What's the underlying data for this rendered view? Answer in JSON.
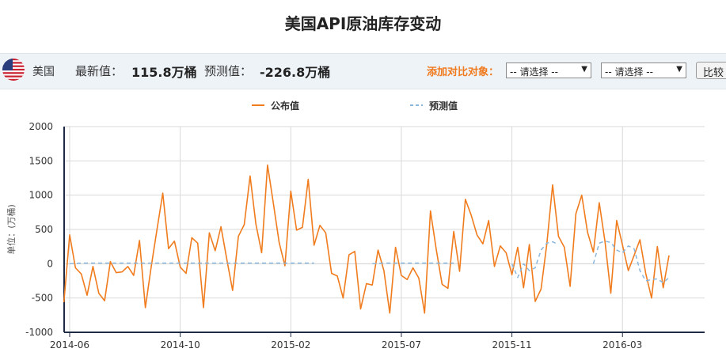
{
  "page": {
    "title": "美国API原油库存变动"
  },
  "infobar": {
    "country": "美国",
    "latest_label": "最新值：",
    "latest_value": "115.8万桶",
    "forecast_label": "预测值：",
    "forecast_value": "-226.8万桶",
    "compare_label": "添加对比对象：",
    "select1_value": "-- 请选择 --",
    "select2_value": "-- 请选择 --",
    "compare_button": "比较"
  },
  "chart_data": {
    "type": "line",
    "ylabel": "单位：(万桶)",
    "ylim": [
      -1000,
      2000
    ],
    "yticks": [
      2000,
      1500,
      1000,
      500,
      0,
      -500,
      -1000
    ],
    "xlim": [
      0,
      112
    ],
    "xticks": [
      {
        "label": "2014-06",
        "x": 0
      },
      {
        "label": "2014-10",
        "x": 19
      },
      {
        "label": "2015-02",
        "x": 38
      },
      {
        "label": "2015-07",
        "x": 57
      },
      {
        "label": "2015-11",
        "x": 76
      },
      {
        "label": "2016-03",
        "x": 95
      }
    ],
    "grid": true,
    "legend_position": "top",
    "series": [
      {
        "name": "公布值",
        "color": "#f07c1e",
        "style": "solid",
        "points": [
          [
            -1,
            -560
          ],
          [
            0,
            420
          ],
          [
            1,
            -60
          ],
          [
            2,
            -150
          ],
          [
            3,
            -460
          ],
          [
            4,
            -40
          ],
          [
            5,
            -430
          ],
          [
            6,
            -540
          ],
          [
            7,
            30
          ],
          [
            8,
            -130
          ],
          [
            9,
            -120
          ],
          [
            10,
            -40
          ],
          [
            11,
            -170
          ],
          [
            12,
            340
          ],
          [
            13,
            -640
          ],
          [
            14,
            -50
          ],
          [
            15,
            500
          ],
          [
            16,
            1030
          ],
          [
            17,
            220
          ],
          [
            18,
            330
          ],
          [
            19,
            -50
          ],
          [
            20,
            -140
          ],
          [
            21,
            380
          ],
          [
            22,
            300
          ],
          [
            23,
            -640
          ],
          [
            24,
            450
          ],
          [
            25,
            190
          ],
          [
            26,
            540
          ],
          [
            27,
            70
          ],
          [
            28,
            -390
          ],
          [
            29,
            400
          ],
          [
            30,
            570
          ],
          [
            31,
            1280
          ],
          [
            32,
            580
          ],
          [
            33,
            160
          ],
          [
            34,
            1440
          ],
          [
            35,
            880
          ],
          [
            36,
            310
          ],
          [
            37,
            -30
          ],
          [
            38,
            1060
          ],
          [
            39,
            490
          ],
          [
            40,
            530
          ],
          [
            41,
            1230
          ],
          [
            42,
            270
          ],
          [
            43,
            560
          ],
          [
            44,
            450
          ],
          [
            45,
            -140
          ],
          [
            46,
            -180
          ],
          [
            47,
            -500
          ],
          [
            48,
            130
          ],
          [
            49,
            180
          ],
          [
            50,
            -660
          ],
          [
            51,
            -290
          ],
          [
            52,
            -310
          ],
          [
            53,
            200
          ],
          [
            54,
            -100
          ],
          [
            55,
            -720
          ],
          [
            56,
            240
          ],
          [
            57,
            -170
          ],
          [
            58,
            -230
          ],
          [
            59,
            -60
          ],
          [
            60,
            -210
          ],
          [
            61,
            -720
          ],
          [
            62,
            770
          ],
          [
            63,
            210
          ],
          [
            64,
            -300
          ],
          [
            65,
            -360
          ],
          [
            66,
            470
          ],
          [
            67,
            -110
          ],
          [
            68,
            940
          ],
          [
            69,
            710
          ],
          [
            70,
            420
          ],
          [
            71,
            290
          ],
          [
            72,
            630
          ],
          [
            73,
            -40
          ],
          [
            74,
            260
          ],
          [
            75,
            160
          ],
          [
            76,
            -160
          ],
          [
            77,
            240
          ],
          [
            78,
            -350
          ],
          [
            79,
            280
          ],
          [
            80,
            -550
          ],
          [
            81,
            -370
          ],
          [
            82,
            290
          ],
          [
            83,
            1150
          ],
          [
            84,
            400
          ],
          [
            85,
            240
          ],
          [
            86,
            -330
          ],
          [
            87,
            730
          ],
          [
            88,
            1000
          ],
          [
            89,
            460
          ],
          [
            90,
            170
          ],
          [
            91,
            890
          ],
          [
            92,
            320
          ],
          [
            93,
            -430
          ],
          [
            94,
            630
          ],
          [
            95,
            270
          ],
          [
            96,
            -100
          ],
          [
            97,
            120
          ],
          [
            98,
            350
          ],
          [
            99,
            -140
          ],
          [
            100,
            -500
          ],
          [
            101,
            250
          ],
          [
            102,
            -350
          ],
          [
            103,
            120
          ]
        ]
      },
      {
        "name": "预测值",
        "color": "#8ab7de",
        "style": "dashed",
        "points": [
          [
            0,
            0
          ],
          [
            2,
            10
          ],
          [
            4,
            10
          ],
          [
            6,
            10
          ],
          [
            8,
            10
          ],
          [
            10,
            10
          ],
          [
            12,
            10
          ],
          [
            14,
            10
          ],
          [
            16,
            10
          ],
          [
            18,
            10
          ],
          [
            20,
            10
          ],
          [
            22,
            10
          ],
          [
            24,
            10
          ],
          [
            26,
            10
          ],
          [
            28,
            10
          ],
          [
            30,
            10
          ],
          [
            32,
            10
          ],
          [
            34,
            10
          ],
          [
            36,
            10
          ],
          [
            38,
            10
          ],
          [
            40,
            10
          ],
          [
            42,
            10
          ],
          [
            44,
            null
          ],
          [
            52,
            0
          ],
          [
            54,
            10
          ],
          [
            56,
            10
          ],
          [
            58,
            10
          ],
          [
            60,
            10
          ],
          [
            62,
            10
          ],
          [
            64,
            10
          ],
          [
            66,
            10
          ],
          [
            68,
            null
          ],
          [
            76,
            0
          ],
          [
            77,
            -200
          ],
          [
            78,
            0
          ],
          [
            79,
            -100
          ],
          [
            80,
            -60
          ],
          [
            81,
            200
          ],
          [
            82,
            300
          ],
          [
            83,
            320
          ],
          [
            84,
            280
          ],
          [
            85,
            null
          ],
          [
            89,
            null
          ],
          [
            90,
            0
          ],
          [
            91,
            300
          ],
          [
            92,
            330
          ],
          [
            93,
            310
          ],
          [
            94,
            200
          ],
          [
            95,
            160
          ],
          [
            96,
            260
          ],
          [
            97,
            220
          ],
          [
            98,
            -100
          ],
          [
            99,
            -250
          ],
          [
            100,
            -230
          ],
          [
            101,
            -220
          ],
          [
            102,
            -280
          ],
          [
            103,
            -200
          ]
        ]
      }
    ]
  }
}
